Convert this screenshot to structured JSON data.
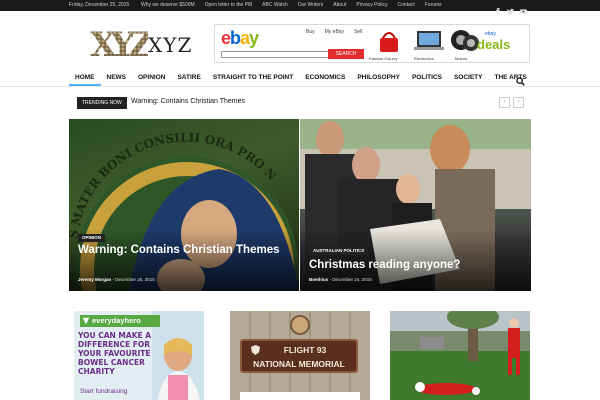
{
  "topbar": {
    "date": "Friday, December 25, 2015",
    "links": [
      "Why we deserve $500M",
      "Open letter to the PM",
      "ABC Watch",
      "Our Writers",
      "About",
      "Privacy Policy",
      "Contact",
      "Forums"
    ],
    "social_icons": [
      "facebook-icon",
      "twitter-icon",
      "youtube-icon"
    ]
  },
  "header": {
    "logo_text": "XYZ",
    "ad": {
      "brand": "ebay",
      "tabs": [
        "Buy",
        "My eBay",
        "Sell"
      ],
      "search_button": "SEARCH",
      "products": [
        "Fashion Gal-ery",
        "Electronics",
        "Motors"
      ],
      "deals_label": "deals",
      "deals_brand": "ebay"
    }
  },
  "nav": {
    "items": [
      "HOME",
      "NEWS",
      "OPINION",
      "SATIRE",
      "STRAIGHT TO THE POINT",
      "ECONOMICS",
      "PHILOSOPHY",
      "POLITICS",
      "SOCIETY",
      "THE ARTS"
    ],
    "active": "HOME"
  },
  "trending": {
    "badge": "TRENDING NOW",
    "headline": "Warning: Contains Christian Themes",
    "prev": "‹",
    "next": "›"
  },
  "featured": [
    {
      "category": "OPINION",
      "title": "Warning: Contains Christian Themes",
      "author": "Jeremy Morgan",
      "date": "December 25, 2015",
      "halo_text": "S MATER BONI CONSILII ORA PRO NOBIS"
    },
    {
      "category": "AUSTRALIAN POLITICS",
      "title": "Christmas reading anyone?",
      "author": "Boethius",
      "date": "December 24, 2015"
    }
  ],
  "cards": [
    {
      "brand": "everydayhero",
      "slogan": "YOU CAN MAKE A DIFFERENCE FOR YOUR FAVOURITE BOWEL CANCER CHARITY",
      "cta": "Start fundraising"
    },
    {
      "sign_line1": "FLIGHT 93",
      "sign_line2": "NATIONAL MEMORIAL"
    },
    {}
  ],
  "colors": {
    "accent": "#4db2ec",
    "topbar_bg": "#1a1a1a",
    "ebay_red": "#e53238",
    "ebay_blue": "#0064d2",
    "ebay_yellow": "#f5af02",
    "ebay_green": "#86b817"
  }
}
